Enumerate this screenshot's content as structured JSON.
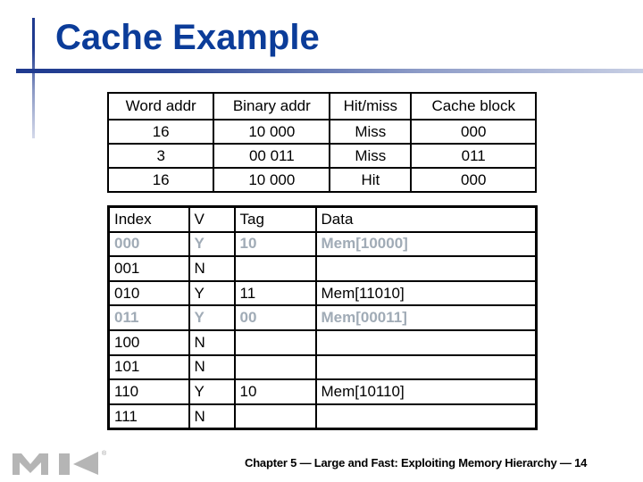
{
  "slide": {
    "title": "Cache Example",
    "footer": "Chapter 5 — Large and Fast: Exploiting Memory Hierarchy — 14",
    "logo_icon": "mk-publisher-logo",
    "logo_mark": "®"
  },
  "access_table": {
    "headers": [
      "Word addr",
      "Binary addr",
      "Hit/miss",
      "Cache block"
    ],
    "rows": [
      [
        "16",
        "10 000",
        "Miss",
        "000"
      ],
      [
        "3",
        "00 011",
        "Miss",
        "011"
      ],
      [
        "16",
        "10 000",
        "Hit",
        "000"
      ]
    ]
  },
  "cache_table": {
    "headers": [
      "Index",
      "V",
      "Tag",
      "Data"
    ],
    "rows": [
      {
        "cells": [
          "000",
          "Y",
          "10",
          "Mem[10000]"
        ],
        "highlighted": true
      },
      {
        "cells": [
          "001",
          "N",
          "",
          ""
        ],
        "highlighted": false
      },
      {
        "cells": [
          "010",
          "Y",
          "11",
          "Mem[11010]"
        ],
        "highlighted": false
      },
      {
        "cells": [
          "011",
          "Y",
          "00",
          "Mem[00011]"
        ],
        "highlighted": true
      },
      {
        "cells": [
          "100",
          "N",
          "",
          ""
        ],
        "highlighted": false
      },
      {
        "cells": [
          "101",
          "N",
          "",
          ""
        ],
        "highlighted": false
      },
      {
        "cells": [
          "110",
          "Y",
          "10",
          "Mem[10110]"
        ],
        "highlighted": false
      },
      {
        "cells": [
          "111",
          "N",
          "",
          ""
        ],
        "highlighted": false
      }
    ],
    "highlight_color": "#a0abb6"
  },
  "colors": {
    "title": "#0b3c99",
    "accent_bar": "#1f3a8f",
    "logo_gray": "#b5b5b5"
  }
}
